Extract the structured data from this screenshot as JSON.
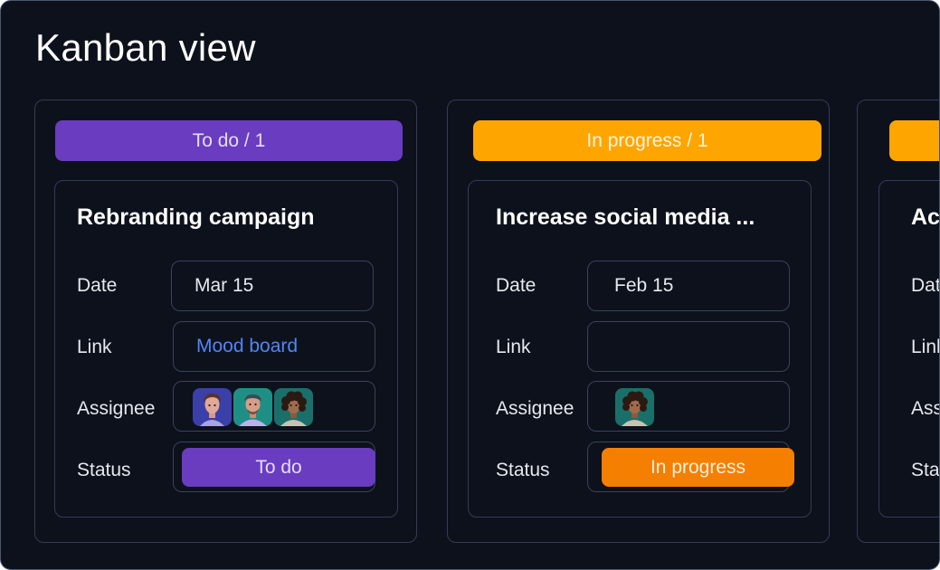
{
  "page": {
    "title": "Kanban view"
  },
  "colors": {
    "todo": "#6a3cbf",
    "in_progress_header": "#ffa500",
    "in_progress_pill": "#f57f00",
    "link": "#4f86f7",
    "background": "#0d111b"
  },
  "columns": [
    {
      "header": "To do / 1",
      "card": {
        "title": "Rebranding campaign",
        "date_label": "Date",
        "date_value": "Mar 15",
        "link_label": "Link",
        "link_value": "Mood board",
        "assignee_label": "Assignee",
        "assignees": [
          "woman-avatar",
          "man-avatar",
          "curly-hair-avatar"
        ],
        "status_label": "Status",
        "status_value": "To do"
      }
    },
    {
      "header": "In progress / 1",
      "card": {
        "title": "Increase social media ...",
        "date_label": "Date",
        "date_value": "Feb 15",
        "link_label": "Link",
        "link_value": "",
        "assignee_label": "Assignee",
        "assignees": [
          "curly-hair-avatar"
        ],
        "status_label": "Status",
        "status_value": "In progress"
      }
    },
    {
      "header": "",
      "card": {
        "title": "Acc",
        "date_label": "Dat",
        "link_label": "Link",
        "assignee_label": "Ass",
        "status_label": "Stat"
      }
    }
  ]
}
